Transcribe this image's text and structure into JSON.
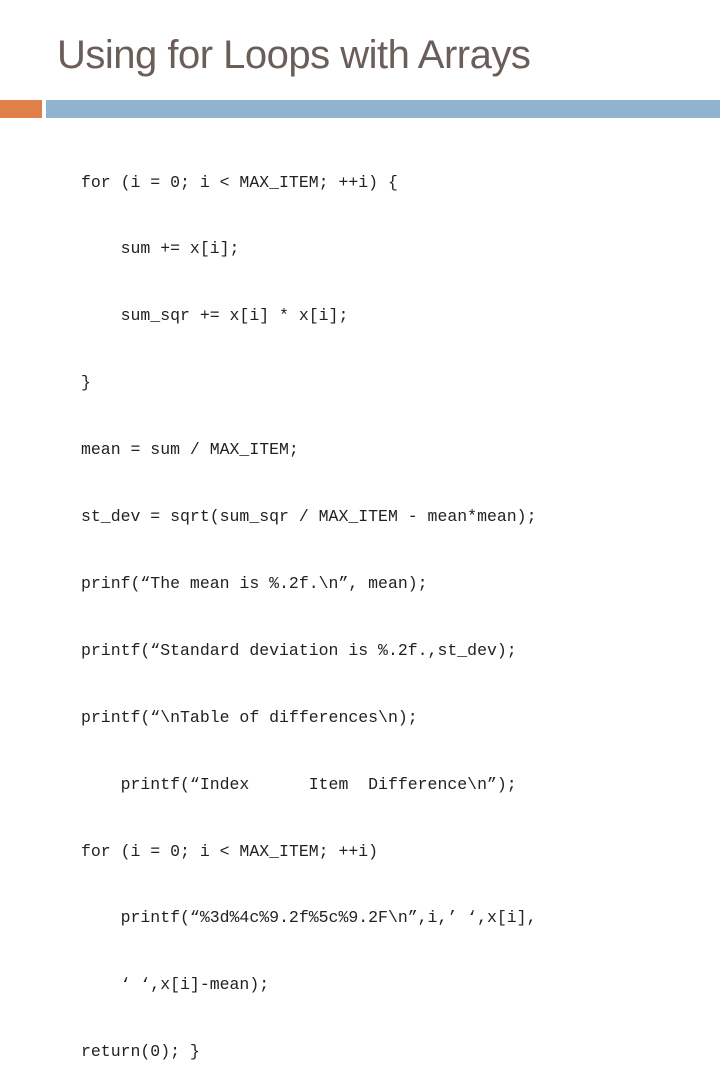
{
  "slide": {
    "title": "Using for Loops with Arrays",
    "accent_colors": {
      "orange": "#e07f47",
      "blue": "#92b3cf",
      "title": "#6b5d58"
    },
    "code_lines": [
      "for (i = 0; i < MAX_ITEM; ++i) {",
      "    sum += x[i];",
      "    sum_sqr += x[i] * x[i];",
      "}",
      "mean = sum / MAX_ITEM;",
      "st_dev = sqrt(sum_sqr / MAX_ITEM - mean*mean);",
      "prinf(“The mean is %.2f.\\n”, mean);",
      "printf(“Standard deviation is %.2f.,st_dev);",
      "printf(“\\nTable of differences\\n);",
      "    printf(“Index      Item  Difference\\n”);",
      "for (i = 0; i < MAX_ITEM; ++i)",
      "    printf(“%3d%4c%9.2f%5c%9.2F\\n”,i,’ ‘,x[i],",
      "    ‘ ‘,x[i]-mean);",
      "return(0); }"
    ]
  }
}
